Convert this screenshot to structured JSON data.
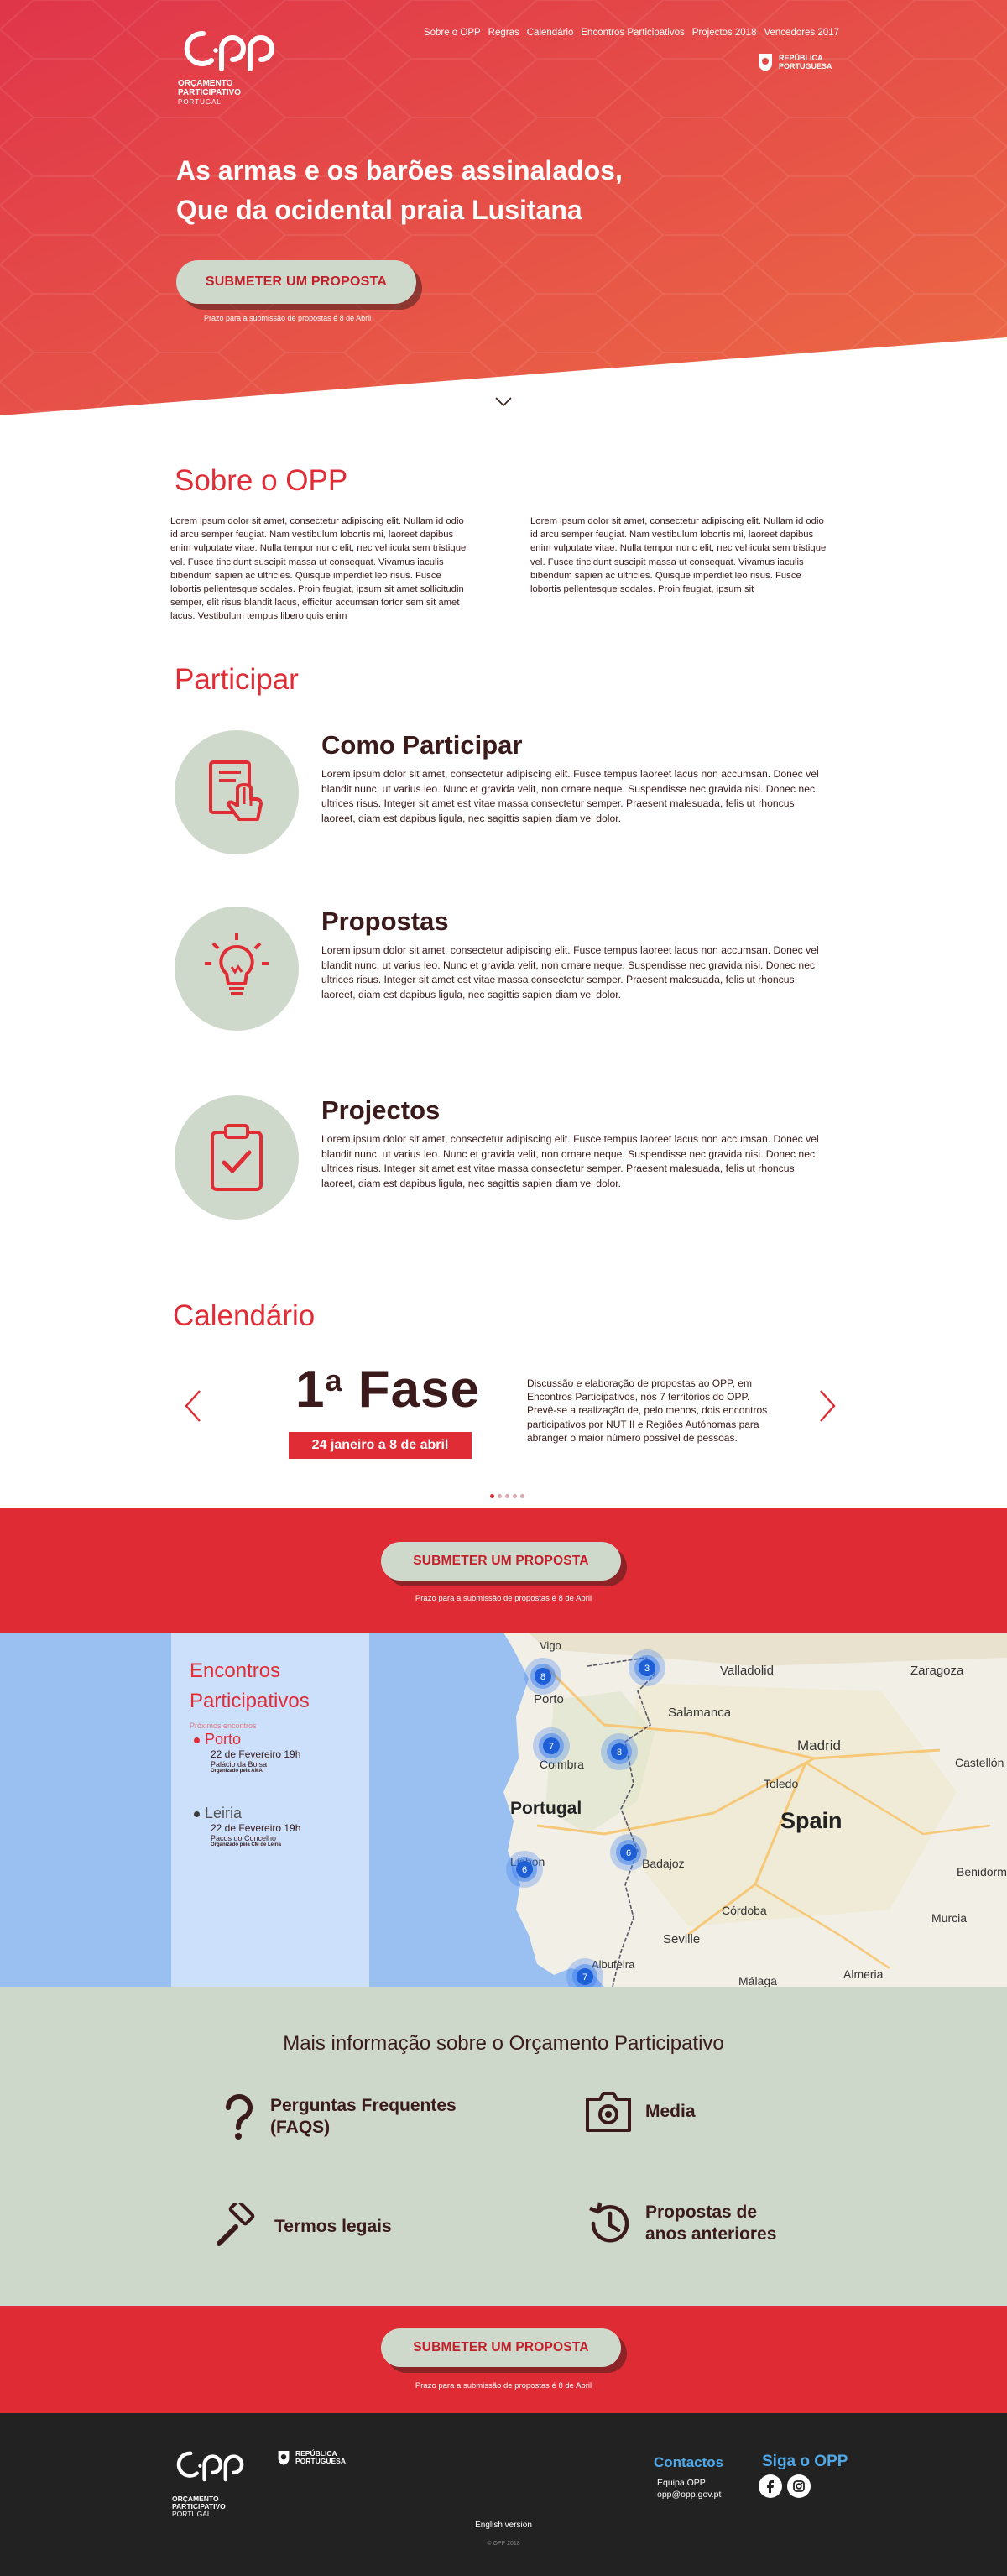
{
  "brand": {
    "logo_text": "opp",
    "logo_line1": "ORÇAMENTO",
    "logo_line2": "PARTICIPATIVO",
    "logo_line3": "PORTUGAL",
    "republica_line1": "REPÚBLICA",
    "republica_line2": "PORTUGUESA"
  },
  "nav": {
    "items": [
      "Sobre o OPP",
      "Regras",
      "Calendário",
      "Encontros Participativos",
      "Projectos 2018",
      "Vencedores 2017"
    ]
  },
  "hero": {
    "headline_line1": "As armas e os barões assinalados,",
    "headline_line2": "Que da ocidental  praia Lusitana",
    "cta_label": "SUBMETER UM PROPOSTA",
    "deadline": "Prazo para a submissão de propostas é 8 de Abril"
  },
  "sobre": {
    "title": "Sobre o OPP",
    "col1": "Lorem ipsum dolor sit amet, consectetur adipiscing elit. Nullam id odio id arcu semper feugiat. Nam vestibulum lobortis mi, laoreet dapibus enim vulputate vitae. Nulla tempor nunc elit, nec vehicula sem tristique vel. Fusce tincidunt suscipit massa ut consequat. Vivamus iaculis bibendum sapien ac ultricies. Quisque imperdiet leo risus. Fusce lobortis pellentesque sodales. Proin feugiat, ipsum sit amet sollicitudin semper, elit risus blandit lacus, efficitur accumsan tortor sem sit amet lacus. Vestibulum tempus libero quis enim",
    "col2": "Lorem ipsum dolor sit amet, consectetur adipiscing elit. Nullam id odio id arcu semper feugiat. Nam vestibulum lobortis mi, laoreet dapibus enim vulputate vitae. Nulla tempor nunc elit, nec vehicula sem tristique vel. Fusce tincidunt suscipit massa ut consequat. Vivamus iaculis bibendum sapien ac ultricies. Quisque imperdiet leo risus. Fusce lobortis pellentesque sodales. Proin feugiat, ipsum sit"
  },
  "participar": {
    "title": "Participar",
    "items": [
      {
        "title": "Como Participar",
        "text": "Lorem ipsum dolor sit amet, consectetur adipiscing elit. Fusce tempus laoreet lacus non accumsan. Donec vel blandit nunc, ut varius leo. Nunc et gravida velit, non ornare neque. Suspendisse nec gravida nisi. Donec nec ultrices risus. Integer sit amet est vitae massa consectetur semper. Praesent malesuada, felis ut rhoncus laoreet, diam est dapibus ligula, nec sagittis sapien diam vel dolor.",
        "icon": "hand-touch-icon"
      },
      {
        "title": "Propostas",
        "text": "Lorem ipsum dolor sit amet, consectetur adipiscing elit. Fusce tempus laoreet lacus non accumsan. Donec vel blandit nunc, ut varius leo. Nunc et gravida velit, non ornare neque. Suspendisse nec gravida nisi. Donec nec ultrices risus. Integer sit amet est vitae massa consectetur semper. Praesent malesuada, felis ut rhoncus laoreet, diam est dapibus ligula, nec sagittis sapien diam vel dolor.",
        "icon": "lightbulb-icon"
      },
      {
        "title": "Projectos",
        "text": "Lorem ipsum dolor sit amet, consectetur adipiscing elit. Fusce tempus laoreet lacus non accumsan. Donec vel blandit nunc, ut varius leo. Nunc et gravida velit, non ornare neque. Suspendisse nec gravida nisi. Donec nec ultrices risus. Integer sit amet est vitae massa consectetur semper. Praesent malesuada, felis ut rhoncus laoreet, diam est dapibus ligula, nec sagittis sapien diam vel dolor.",
        "icon": "clipboard-check-icon"
      }
    ]
  },
  "calendario": {
    "title": "Calendário",
    "phase_num": "1",
    "phase_sup": "a",
    "phase_word": "Fase",
    "phase_dates": "24 janeiro a 8 de abril",
    "phase_text": "Discussão e elaboração de propostas ao OPP, em Encontros Participativos, nos 7 territórios do OPP. Prevê-se a realização de, pelo menos, dois encontros participativos por NUT II e Regiões Autónomas para abranger o maior número possível de pessoas.",
    "dots": 5,
    "active_dot": 0
  },
  "cta_band": {
    "label": "SUBMETER UM PROPOSTA",
    "deadline": "Prazo para a submissão de propostas é 8 de Abril"
  },
  "encontros": {
    "title_line1": "Encontros",
    "title_line2": "Participativos",
    "next_label": "Próximos encontros",
    "events": [
      {
        "city": "Porto",
        "date": "22 de Fevereiro 19h",
        "place": "Palácio da Bolsa",
        "org": "Organizado pela AMA"
      },
      {
        "city": "Leiria",
        "date": "22 de Fevereiro 19h",
        "place": "Paços do Concelho",
        "org": "Organizado pela CM de Leiria"
      }
    ],
    "map": {
      "country_labels": [
        "Portugal",
        "Spain"
      ],
      "city_labels": [
        "Vigo",
        "Porto",
        "Coimbra",
        "Lisbon",
        "Valladolid",
        "Salamanca",
        "Zaragoza",
        "Madrid",
        "Toledo",
        "Badajoz",
        "Córdoba",
        "Seville",
        "Albufeira",
        "Málaga",
        "Almeria",
        "Castellón de la Plana",
        "Benidorm",
        "Murcia"
      ],
      "cluster_counts": [
        "8",
        "3",
        "7",
        "8",
        "6",
        "6",
        "7"
      ]
    }
  },
  "mais_info": {
    "title": "Mais informação sobre o Orçamento Participativo",
    "items": [
      {
        "label_line1": "Perguntas Frequentes",
        "label_line2": "(FAQS)",
        "icon": "question-icon"
      },
      {
        "label_line1": "Media",
        "label_line2": "",
        "icon": "camera-icon"
      },
      {
        "label_line1": "Termos legais",
        "label_line2": "",
        "icon": "gavel-icon"
      },
      {
        "label_line1": "Propostas de",
        "label_line2": "anos anteriores",
        "icon": "history-icon"
      }
    ]
  },
  "cta_band2": {
    "label": "SUBMETER UM PROPOSTA",
    "deadline": "Prazo para a submissão de propostas é 8 de Abril"
  },
  "footer": {
    "contactos_title": "Contactos",
    "contact_line1": "Equipa OPP",
    "contact_line2": "opp@opp.gov.pt",
    "siga_title": "Siga o OPP",
    "english": "English version",
    "copyright": "© OPP 2018"
  },
  "colors": {
    "primary_red": "#df2c35",
    "sage": "#cfd9cb",
    "dark_brown": "#3a1a1a",
    "footer_blue": "#4fa8e8"
  }
}
